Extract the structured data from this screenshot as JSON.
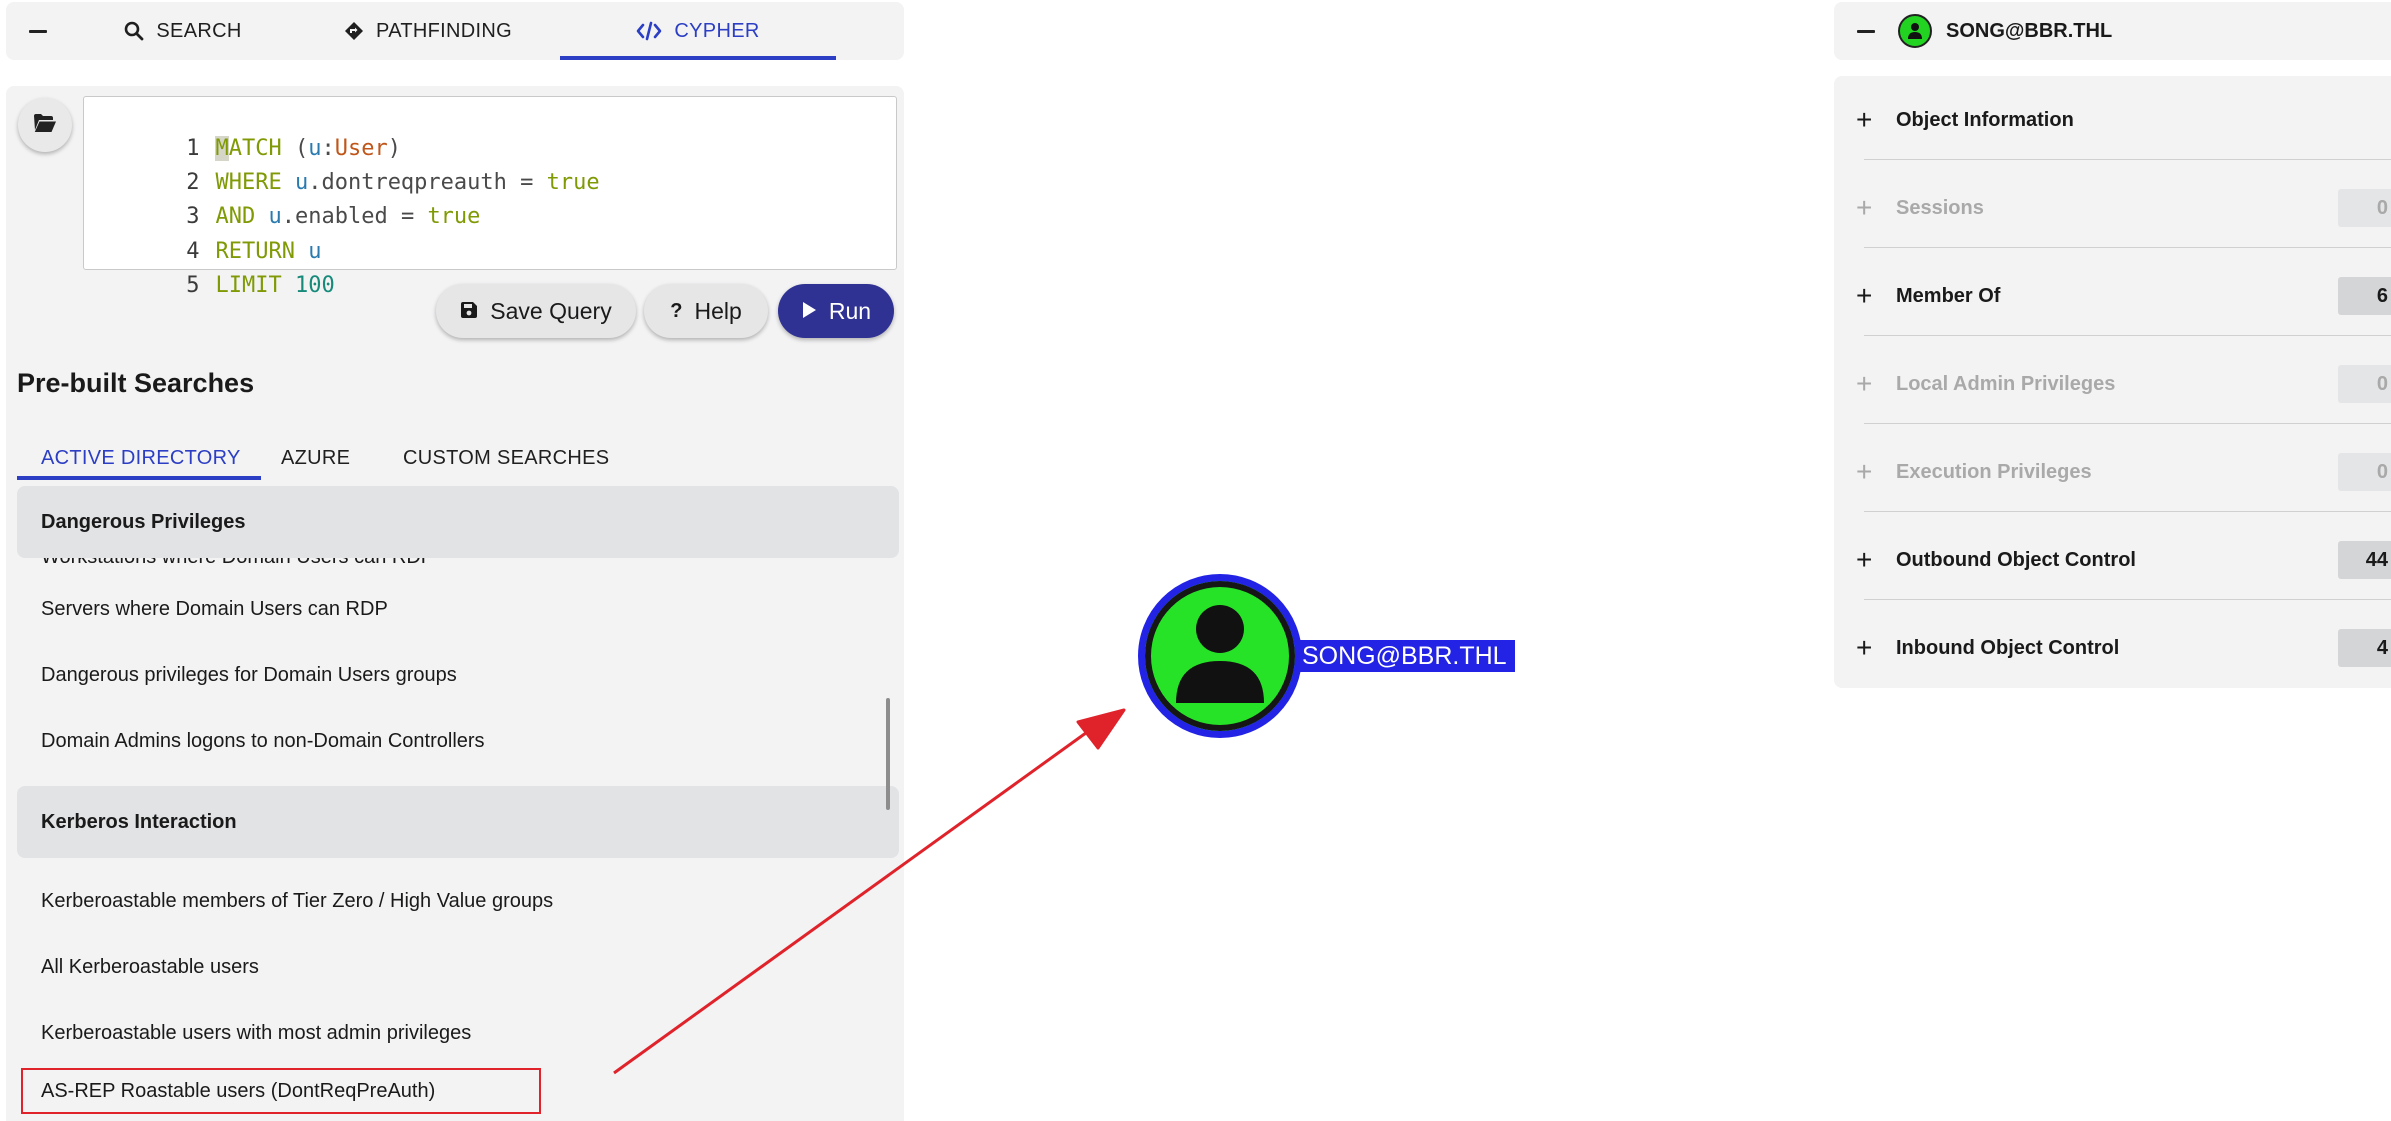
{
  "topbar": {
    "tabs": [
      {
        "label": "SEARCH",
        "icon": "search-icon"
      },
      {
        "label": "PATHFINDING",
        "icon": "route-diamond-icon"
      },
      {
        "label": "CYPHER",
        "icon": "code-icon",
        "active": true
      }
    ]
  },
  "editor": {
    "lines": [
      {
        "n": "1"
      },
      {
        "n": "2"
      },
      {
        "n": "3"
      },
      {
        "n": "4"
      },
      {
        "n": "5"
      }
    ],
    "tokens": {
      "l1a": "M",
      "l1b": "ATCH",
      "l1c": " (",
      "l1d": "u",
      "l1e": ":",
      "l1f": "User",
      "l1g": ")",
      "l2a": "WHERE",
      "l2b": " u",
      "l2c": ".dontreqpreauth = ",
      "l2d": "true",
      "l3a": "AND",
      "l3b": " u",
      "l3c": ".enabled = ",
      "l3d": "true",
      "l4a": "RETURN",
      "l4b": " u",
      "l5a": "LIMIT",
      "l5b": " 100"
    }
  },
  "actions": {
    "save_label": "Save Query",
    "help_label": "Help",
    "run_label": "Run"
  },
  "prebuilt": {
    "heading": "Pre-built Searches",
    "tabs": [
      "ACTIVE DIRECTORY",
      "AZURE",
      "CUSTOM SEARCHES"
    ],
    "groups": [
      {
        "title": "Dangerous Privileges"
      },
      {
        "title": "Kerberos Interaction"
      }
    ],
    "items": [
      "Workstations where Domain Users can RDP",
      "Servers where Domain Users can RDP",
      "Dangerous privileges for Domain Users groups",
      "Domain Admins logons to non-Domain Controllers",
      "Kerberoastable members of Tier Zero / High Value groups",
      "All Kerberoastable users",
      "Kerberoastable users with most admin privileges",
      "AS-REP Roastable users (DontReqPreAuth)"
    ]
  },
  "graph": {
    "node_label": "SONG@BBR.THL",
    "node_color": "#27e327",
    "selection_color": "#2323e6",
    "arrow_color": "#e0232b"
  },
  "entity": {
    "title": "SONG@BBR.THL",
    "sections": [
      {
        "label": "Object Information",
        "count": null
      },
      {
        "label": "Sessions",
        "count": "0"
      },
      {
        "label": "Member Of",
        "count": "6"
      },
      {
        "label": "Local Admin Privileges",
        "count": "0"
      },
      {
        "label": "Execution Privileges",
        "count": "0"
      },
      {
        "label": "Outbound Object Control",
        "count": "44"
      },
      {
        "label": "Inbound Object Control",
        "count": "4"
      }
    ]
  }
}
